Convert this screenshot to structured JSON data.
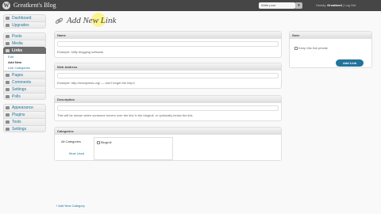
{
  "topbar": {
    "logo_glyph": "W",
    "site_title": "Greatkent's Blog",
    "favorites_value": "Write post",
    "favorites_arrow": "▾",
    "howdy": "Howdy,",
    "username": "Greatkent",
    "separator": "|",
    "logout": "Log Out"
  },
  "menu": {
    "dashboard": "Dashboard",
    "upgrades": "Upgrades",
    "posts": "Posts",
    "media": "Media",
    "links": "Links",
    "links_sub": [
      "Edit",
      "Add New",
      "Link Categories"
    ],
    "pages": "Pages",
    "comments": "Comments",
    "settings": "Settings",
    "polls": "Polls",
    "appearance": "Appearance",
    "plugins": "Plugins",
    "tools": "Tools",
    "settings2": "Settings"
  },
  "page": {
    "title": "Add New Link"
  },
  "name_box": {
    "heading": "Name",
    "hint": "Example: Nifty blogging software"
  },
  "web_box": {
    "heading": "Web Address",
    "hint": "Example: http://wordpress.org/ — don't forget the http://"
  },
  "desc_box": {
    "heading": "Description",
    "hint": "This will be shown when someone hovers over the link in the blogroll, or optionally below the link."
  },
  "cat_box": {
    "heading": "Categories",
    "tab_all": "All Categories",
    "item": "Blogroll",
    "most_used": "Most Used",
    "add_new": "+ Add New Category"
  },
  "save_box": {
    "heading": "Save",
    "private_label": "Keep this link private",
    "button": "Add Link"
  },
  "colors": {
    "adminbar": "#464646",
    "link": "#21759b",
    "button": "#21759b"
  }
}
